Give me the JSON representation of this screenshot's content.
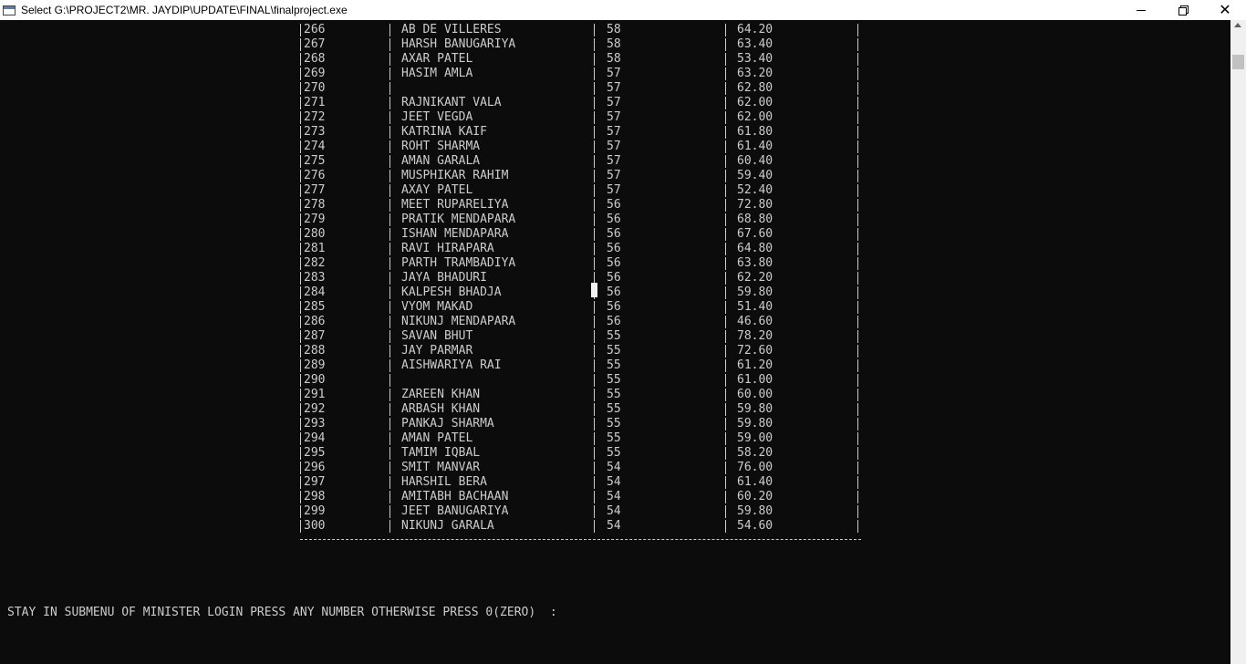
{
  "window": {
    "title": "Select G:\\PROJECT2\\MR. JAYDIP\\UPDATE\\FINAL\\finalproject.exe"
  },
  "table": {
    "rows": [
      {
        "id": "266",
        "name": "AB DE VILLERES",
        "score": "58",
        "percent": "64.20"
      },
      {
        "id": "267",
        "name": "HARSH BANUGARIYA",
        "score": "58",
        "percent": "63.40"
      },
      {
        "id": "268",
        "name": "AXAR PATEL",
        "score": "58",
        "percent": "53.40"
      },
      {
        "id": "269",
        "name": "HASIM AMLA",
        "score": "57",
        "percent": "63.20"
      },
      {
        "id": "270",
        "name": "",
        "score": "57",
        "percent": "62.80"
      },
      {
        "id": "271",
        "name": "RAJNIKANT VALA",
        "score": "57",
        "percent": "62.00"
      },
      {
        "id": "272",
        "name": "JEET VEGDA",
        "score": "57",
        "percent": "62.00"
      },
      {
        "id": "273",
        "name": "KATRINA KAIF",
        "score": "57",
        "percent": "61.80"
      },
      {
        "id": "274",
        "name": "ROHT SHARMA",
        "score": "57",
        "percent": "61.40"
      },
      {
        "id": "275",
        "name": "AMAN GARALA",
        "score": "57",
        "percent": "60.40"
      },
      {
        "id": "276",
        "name": "MUSPHIKAR RAHIM",
        "score": "57",
        "percent": "59.40"
      },
      {
        "id": "277",
        "name": "AXAY PATEL",
        "score": "57",
        "percent": "52.40"
      },
      {
        "id": "278",
        "name": "MEET RUPARELIYA",
        "score": "56",
        "percent": "72.80"
      },
      {
        "id": "279",
        "name": "PRATIK MENDAPARA",
        "score": "56",
        "percent": "68.80"
      },
      {
        "id": "280",
        "name": "ISHAN MENDAPARA",
        "score": "56",
        "percent": "67.60"
      },
      {
        "id": "281",
        "name": "RAVI HIRAPARA",
        "score": "56",
        "percent": "64.80"
      },
      {
        "id": "282",
        "name": "PARTH TRAMBADIYA",
        "score": "56",
        "percent": "63.80"
      },
      {
        "id": "283",
        "name": "JAYA BHADURI",
        "score": "56",
        "percent": "62.20"
      },
      {
        "id": "284",
        "name": "KALPESH BHADJA",
        "score": "56",
        "percent": "59.80"
      },
      {
        "id": "285",
        "name": "VYOM MAKAD",
        "score": "56",
        "percent": "51.40"
      },
      {
        "id": "286",
        "name": "NIKUNJ MENDAPARA",
        "score": "56",
        "percent": "46.60"
      },
      {
        "id": "287",
        "name": "SAVAN BHUT",
        "score": "55",
        "percent": "78.20"
      },
      {
        "id": "288",
        "name": "JAY PARMAR",
        "score": "55",
        "percent": "72.60"
      },
      {
        "id": "289",
        "name": "AISHWARIYA RAI",
        "score": "55",
        "percent": "61.20"
      },
      {
        "id": "290",
        "name": "",
        "score": "55",
        "percent": "61.00"
      },
      {
        "id": "291",
        "name": "ZAREEN KHAN",
        "score": "55",
        "percent": "60.00"
      },
      {
        "id": "292",
        "name": "ARBASH KHAN",
        "score": "55",
        "percent": "59.80"
      },
      {
        "id": "293",
        "name": "PANKAJ SHARMA",
        "score": "55",
        "percent": "59.80"
      },
      {
        "id": "294",
        "name": "AMAN PATEL",
        "score": "55",
        "percent": "59.00"
      },
      {
        "id": "295",
        "name": "TAMIM IQBAL",
        "score": "55",
        "percent": "58.20"
      },
      {
        "id": "296",
        "name": "SMIT MANVAR",
        "score": "54",
        "percent": "76.00"
      },
      {
        "id": "297",
        "name": "HARSHIL BERA",
        "score": "54",
        "percent": "61.40"
      },
      {
        "id": "298",
        "name": "AMITABH BACHAAN",
        "score": "54",
        "percent": "60.20"
      },
      {
        "id": "299",
        "name": "JEET BANUGARIYA",
        "score": "54",
        "percent": "59.80"
      },
      {
        "id": "300",
        "name": "NIKUNJ GARALA",
        "score": "54",
        "percent": "54.60"
      }
    ]
  },
  "prompt": {
    "text": "STAY IN SUBMENU OF MINISTER LOGIN PRESS ANY NUMBER OTHERWISE PRESS 0(ZERO)  :"
  },
  "colors": {
    "console_bg": "#0c0c0c",
    "console_fg": "#cccccc",
    "titlebar_bg": "#ffffff"
  },
  "icons": {
    "app": "console-app-icon",
    "minimize": "minimize-icon",
    "maximize": "restore-icon",
    "close": "close-icon"
  }
}
